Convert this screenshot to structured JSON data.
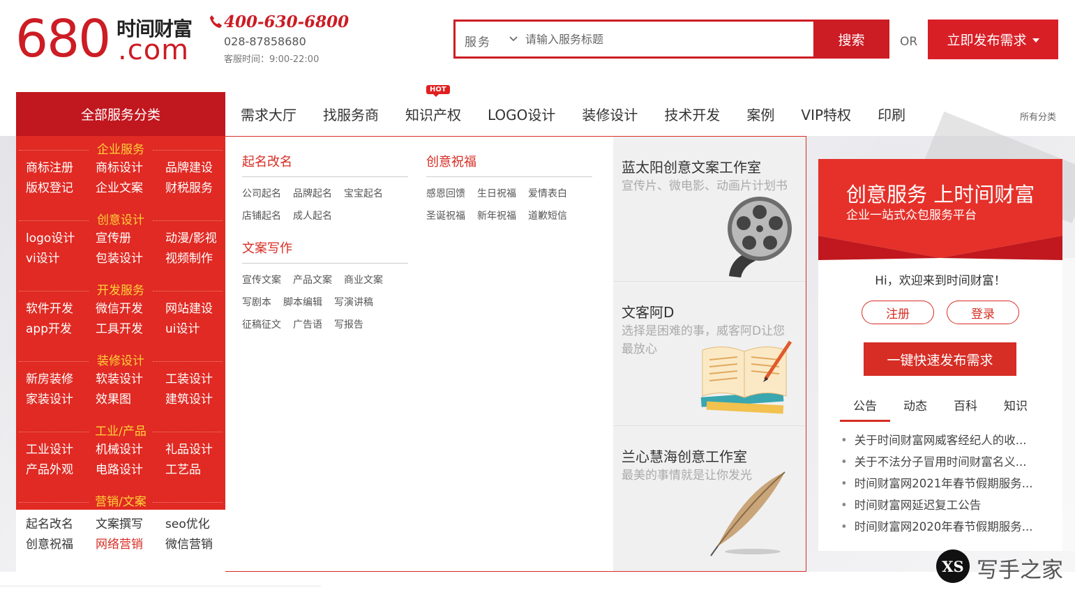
{
  "header": {
    "logo_number": "680",
    "logo_cn": "时间财富",
    "logo_com": ".com",
    "phone": "400-630-6800",
    "phone_sub": "028-87858680",
    "service_time": "客服时间：9:00-22:00",
    "search": {
      "category": "服务",
      "placeholder": "请输入服务标题",
      "button": "搜索"
    },
    "or_text": "OR",
    "publish_button": "立即发布需求"
  },
  "nav": {
    "all_categories": "全部服务分类",
    "items": [
      "需求大厅",
      "找服务商",
      "知识产权",
      "LOGO设计",
      "装修设计",
      "技术开发",
      "案例",
      "VIP特权",
      "印刷"
    ],
    "hot_badge": "HOT",
    "all_link": "所有分类"
  },
  "sidebar": {
    "groups": [
      {
        "title": "企业服务",
        "items": [
          "商标注册",
          "商标设计",
          "品牌建设",
          "版权登记",
          "企业文案",
          "财税服务"
        ]
      },
      {
        "title": "创意设计",
        "items": [
          "logo设计",
          "宣传册",
          "动漫/影视",
          "vi设计",
          "包装设计",
          "视频制作"
        ]
      },
      {
        "title": "开发服务",
        "items": [
          "软件开发",
          "微信开发",
          "网站建设",
          "app开发",
          "工具开发",
          "ui设计"
        ]
      },
      {
        "title": "装修设计",
        "items": [
          "新房装修",
          "软装设计",
          "工装设计",
          "家装设计",
          "效果图",
          "建筑设计"
        ]
      },
      {
        "title": "工业/产品",
        "items": [
          "工业设计",
          "机械设计",
          "礼品设计",
          "产品外观",
          "电路设计",
          "工艺品"
        ]
      },
      {
        "title": "营销/文案",
        "items": [
          "起名改名",
          "文案撰写",
          "seo优化",
          "创意祝福",
          "网络营销",
          "微信营销"
        ]
      }
    ]
  },
  "panel": {
    "columns": [
      {
        "title": "起名改名",
        "links": [
          "公司起名",
          "品牌起名",
          "宝宝起名",
          "店铺起名",
          "成人起名"
        ]
      },
      {
        "title": "创意祝福",
        "links": [
          "感恩回馈",
          "生日祝福",
          "爱情表白",
          "圣诞祝福",
          "新年祝福",
          "道歉短信"
        ]
      },
      {
        "title": "文案写作",
        "links": [
          "宣传文案",
          "产品文案",
          "商业文案",
          "写剧本",
          "脚本编辑",
          "写演讲稿",
          "征稿征文",
          "广告语",
          "写报告"
        ]
      }
    ],
    "cards": [
      {
        "title": "蓝太阳创意文案工作室",
        "desc": "宣传片、微电影、动画片计划书",
        "icon": "film-reel-icon"
      },
      {
        "title": "文客阿D",
        "desc": "选择是困难的事，威客阿D让您最放心",
        "icon": "open-book-icon"
      },
      {
        "title": "兰心慧海创意工作室",
        "desc": "最美的事情就是让你发光",
        "icon": "quill-pen-icon"
      }
    ]
  },
  "user_panel": {
    "banner_title": "创意服务 上时间财富",
    "banner_sub": "企业一站式众包服务平台",
    "greeting": "Hi，欢迎来到时间财富！",
    "register": "注册",
    "login": "登录",
    "quick_publish": "一键快速发布需求",
    "tabs": [
      "公告",
      "动态",
      "百科",
      "知识"
    ],
    "news": [
      "关于时间财富网威客经纪人的收...",
      "关于不法分子冒用时间财富名义...",
      "时间财富网2021年春节假期服务...",
      "时间财富网延迟复工公告",
      "时间财富网2020年春节假期服务..."
    ]
  },
  "watermark": {
    "badge": "XS",
    "text": "写手之家"
  },
  "colors": {
    "brand_red": "#d62d24",
    "dark_red": "#c1171e",
    "gold": "#ffd23a"
  }
}
